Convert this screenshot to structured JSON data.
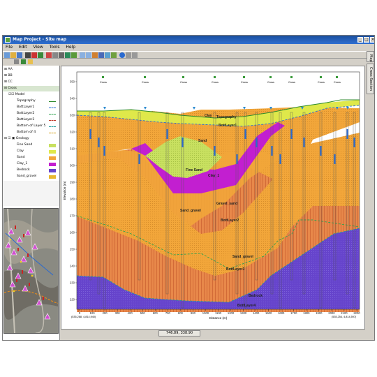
{
  "window": {
    "title": "Map Project - Site map"
  },
  "menu": [
    "File",
    "Edit",
    "View",
    "Tools",
    "Help"
  ],
  "tree": {
    "sections": [
      {
        "label": "AA"
      },
      {
        "label": "BB"
      },
      {
        "label": "CC"
      },
      {
        "label": "Cross"
      }
    ],
    "model": {
      "label": "Model",
      "items": [
        {
          "label": "Topography",
          "color": "#2c8a2c",
          "style": "line"
        },
        {
          "label": "BottLayer1",
          "color": "#2a6fd6",
          "style": "dash"
        },
        {
          "label": "BottLayer2",
          "color": "#2ea44f",
          "style": "dash"
        },
        {
          "label": "BottLayer3",
          "color": "#c0392b",
          "style": "dash"
        },
        {
          "label": "Bottom of Layer 5",
          "color": "#1e9c9c",
          "style": "dash"
        },
        {
          "label": "Bottom of 4",
          "color": "#d4a017",
          "style": "dash"
        }
      ]
    },
    "geology": {
      "label": "Geology",
      "items": [
        {
          "label": "Fine Sand",
          "color": "#c8e060"
        },
        {
          "label": "Clay",
          "color": "#dfe84a"
        },
        {
          "label": "Sand",
          "color": "#f2a63a"
        },
        {
          "label": "Clay_1",
          "color": "#c21fd0"
        },
        {
          "label": "Bedrock",
          "color": "#6644cc"
        },
        {
          "label": "Sand_gravel",
          "color": "#e8b830"
        }
      ]
    }
  },
  "chart": {
    "xlabel": "Distance (m)",
    "ylabel": "Elevation (m)",
    "x_ticks": [
      "0",
      "100",
      "200",
      "300",
      "400",
      "500",
      "600",
      "700",
      "800",
      "900",
      "1000",
      "1100",
      "1200",
      "1300",
      "1400",
      "1500",
      "1600",
      "1700",
      "1800",
      "1900",
      "2000",
      "2100",
      "2200"
    ],
    "y_ticks": [
      "350",
      "340",
      "330",
      "320",
      "310",
      "300",
      "290",
      "280",
      "270",
      "260",
      "250",
      "240",
      "230",
      "220"
    ],
    "left_coord": "(535,288, 4,814,940)",
    "right_coord": "(535,254, 4,814,597)",
    "top_labels": [
      "Cross",
      "Cross",
      "Cross",
      "Cross",
      "Cross",
      "Cross",
      "Cross",
      "Cross",
      "Cross"
    ],
    "unit_labels": [
      "Clay",
      "Topography",
      "BottLayer1",
      "Sand",
      "Fine Sand",
      "Clay_1",
      "Gravel_sand",
      "Sand_gravel",
      "BottLayer2",
      "Sand_gravel",
      "BottLayer3",
      "Bedrock",
      "BottLayer4"
    ]
  },
  "status": {
    "coords": "746.89, 338.90"
  },
  "right_tabs": [
    "Map",
    "Cross-Section"
  ]
}
